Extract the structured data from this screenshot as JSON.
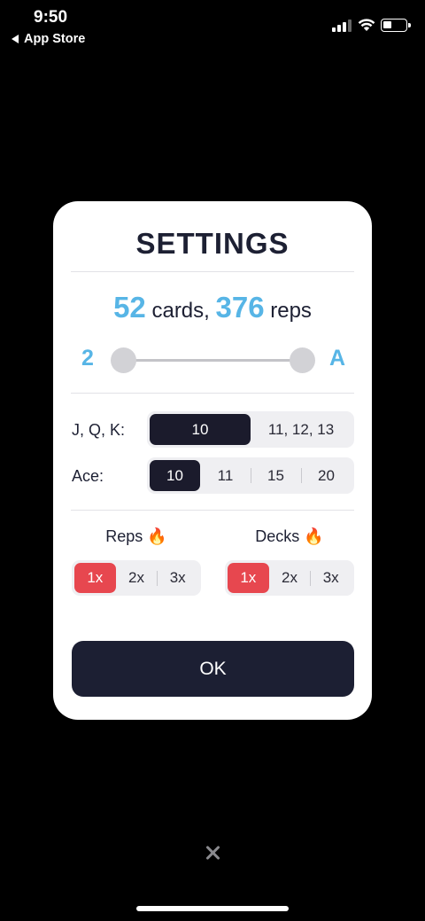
{
  "status_bar": {
    "time": "9:50",
    "back_label": "App Store"
  },
  "settings": {
    "title": "SETTINGS",
    "summary": {
      "cards": "52",
      "cards_label": "cards,",
      "reps": "376",
      "reps_label": "reps"
    },
    "range": {
      "min_label": "2",
      "max_label": "A"
    },
    "face_cards": {
      "label": "J, Q, K:",
      "options": [
        "10",
        "11, 12, 13"
      ],
      "selected": "10"
    },
    "ace": {
      "label": "Ace:",
      "options": [
        "10",
        "11",
        "15",
        "20"
      ],
      "selected": "10"
    },
    "reps": {
      "label": "Reps",
      "icon": "🔥",
      "options": [
        "1x",
        "2x",
        "3x"
      ],
      "selected": "1x"
    },
    "decks": {
      "label": "Decks",
      "icon": "🔥",
      "options": [
        "1x",
        "2x",
        "3x"
      ],
      "selected": "1x"
    },
    "ok_label": "OK"
  },
  "colors": {
    "accent": "#57b5e6",
    "dark": "#1c1f33",
    "selected_red": "#e7474f",
    "background": "#000000"
  }
}
